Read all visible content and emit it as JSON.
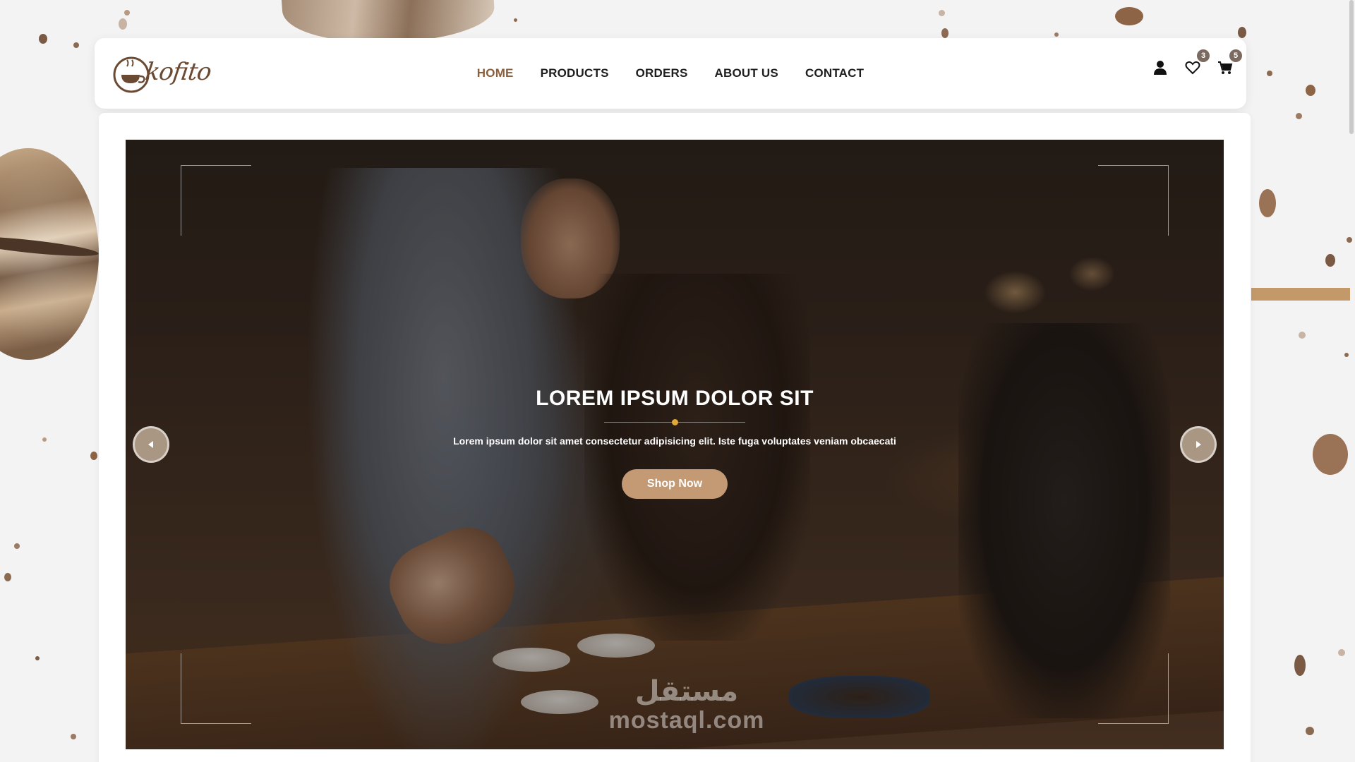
{
  "brand": {
    "logo_text": "kofito"
  },
  "nav": {
    "items": [
      {
        "label": "HOME",
        "active": true
      },
      {
        "label": "PRODUCTS",
        "active": false
      },
      {
        "label": "ORDERS",
        "active": false
      },
      {
        "label": "ABOUT US",
        "active": false
      },
      {
        "label": "CONTACT",
        "active": false
      }
    ]
  },
  "header_icons": {
    "user_icon": "user-icon",
    "wishlist": {
      "icon": "heart-icon",
      "count": "3"
    },
    "cart": {
      "icon": "cart-icon",
      "count": "5"
    }
  },
  "hero": {
    "title": "LOREM IPSUM DOLOR SIT",
    "subtitle": "Lorem ipsum dolor sit amet consectetur adipisicing elit. Iste fuga voluptates veniam obcaecati",
    "cta_label": "Shop Now",
    "prev_icon": "chevron-left-icon",
    "next_icon": "chevron-right-icon"
  },
  "watermark": {
    "arabic": "مستقل",
    "latin": "mostaql.com"
  },
  "colors": {
    "accent": "#8b5e3c",
    "button": "#c49a75",
    "divider_dot": "#e2a838",
    "badge": "#7a6a60"
  }
}
